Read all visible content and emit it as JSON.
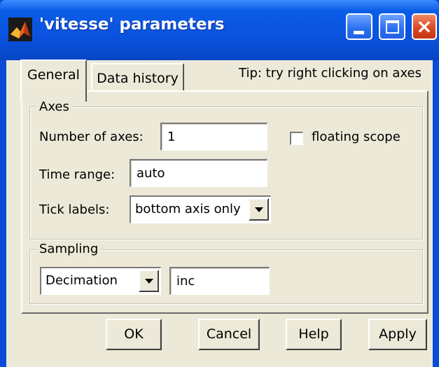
{
  "window": {
    "title": "'vitesse' parameters",
    "app_icon": "matlab-icon",
    "controls": {
      "minimize": "minimize-icon",
      "maximize": "maximize-icon",
      "close": "×"
    }
  },
  "tabs": [
    {
      "label": "General",
      "selected": true
    },
    {
      "label": "Data history",
      "selected": false
    }
  ],
  "tip": "Tip: try right clicking on axes",
  "axes_group": {
    "title": "Axes",
    "number_of_axes_label": "Number of axes:",
    "number_of_axes_value": "1",
    "floating_scope_label": "floating scope",
    "floating_scope_checked": false,
    "time_range_label": "Time range:",
    "time_range_value": "auto",
    "tick_labels_label": "Tick labels:",
    "tick_labels_value": "bottom axis only"
  },
  "sampling_group": {
    "title": "Sampling",
    "mode_value": "Decimation",
    "factor_value": "inc"
  },
  "buttons": {
    "ok": "OK",
    "cancel": "Cancel",
    "help": "Help",
    "apply": "Apply"
  },
  "colors": {
    "titlebar": "#0a52df",
    "dialog_bg": "#ece9d8",
    "close_button": "#d9451d"
  }
}
